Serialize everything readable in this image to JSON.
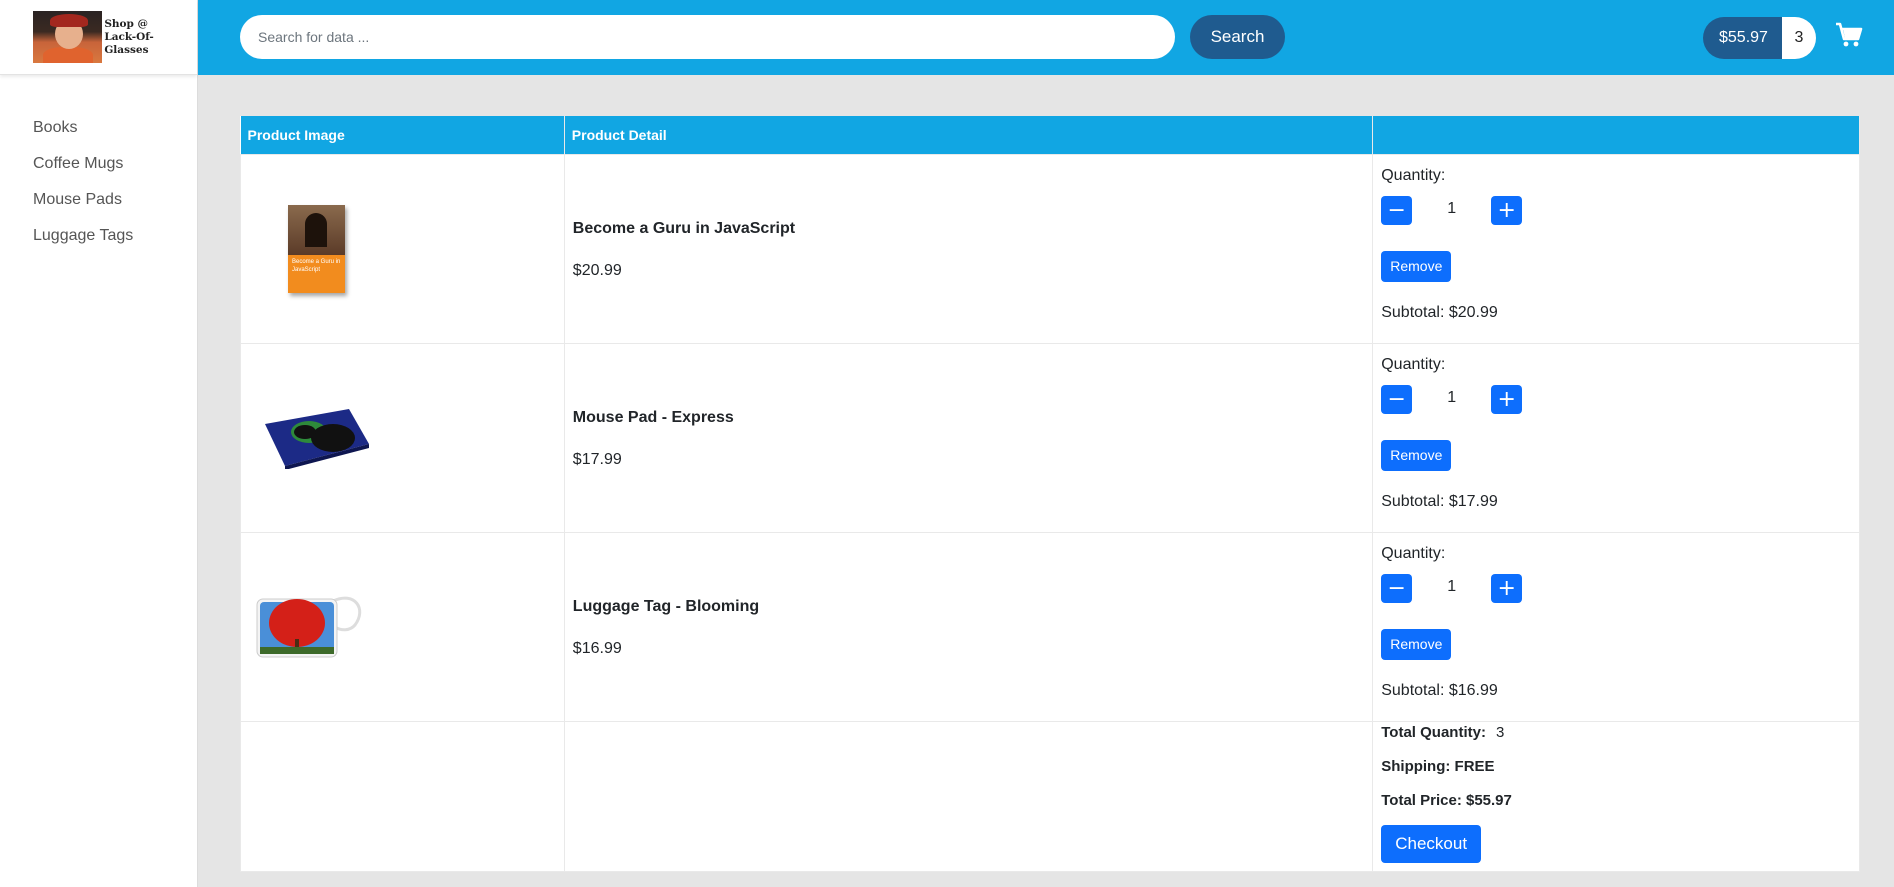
{
  "brand": {
    "line1": "Shop @",
    "line2": "Lack-Of-Glasses"
  },
  "sidebar": {
    "items": [
      {
        "label": "Books"
      },
      {
        "label": "Coffee Mugs"
      },
      {
        "label": "Mouse Pads"
      },
      {
        "label": "Luggage Tags"
      }
    ]
  },
  "header": {
    "search_placeholder": "Search for data ...",
    "search_button": "Search",
    "cart_amount": "$55.97",
    "cart_count": "3",
    "cart_icon": "shopping-cart-icon"
  },
  "table": {
    "headers": {
      "image": "Product Image",
      "detail": "Product Detail",
      "actions": ""
    },
    "rows": [
      {
        "name": "Become a Guru in JavaScript",
        "price": "$20.99",
        "quantity_label": "Quantity:",
        "quantity": "1",
        "minus": "−",
        "plus": "+",
        "remove": "Remove",
        "subtotal": "Subtotal: $20.99",
        "book_cover_text": "Become a Guru in JavaScript"
      },
      {
        "name": "Mouse Pad - Express",
        "price": "$17.99",
        "quantity_label": "Quantity:",
        "quantity": "1",
        "minus": "−",
        "plus": "+",
        "remove": "Remove",
        "subtotal": "Subtotal: $17.99"
      },
      {
        "name": "Luggage Tag - Blooming",
        "price": "$16.99",
        "quantity_label": "Quantity:",
        "quantity": "1",
        "minus": "−",
        "plus": "+",
        "remove": "Remove",
        "subtotal": "Subtotal: $16.99"
      }
    ]
  },
  "totals": {
    "quantity_label": "Total Quantity:",
    "quantity_value": "3",
    "shipping": "Shipping: FREE",
    "total_price": "Total Price: $55.97",
    "checkout": "Checkout"
  },
  "colors": {
    "header": "#11a6e3",
    "dark_button": "#1f5b8f",
    "primary_button": "#0d6efd",
    "background": "#e5e5e5"
  }
}
